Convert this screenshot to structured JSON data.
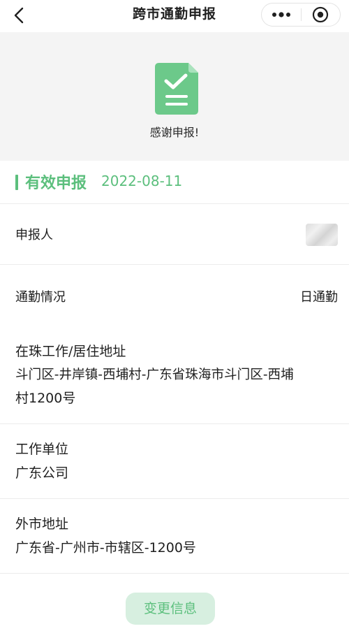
{
  "header": {
    "title": "跨市通勤申报",
    "back_icon": "chevron-left-icon",
    "more_icon": "more-dots-icon",
    "close_icon": "target-close-icon"
  },
  "banner": {
    "icon": "document-check-icon",
    "message": "感谢申报!"
  },
  "section": {
    "title": "有效申报",
    "date": "2022-08-11"
  },
  "fields": {
    "declarant": {
      "label": "申报人"
    },
    "commute": {
      "label": "通勤情况",
      "value": "日通勤"
    },
    "zhuhai_address": {
      "label": "在珠工作/居住地址",
      "value_line1": "斗门区-井岸镇-西埔村-广东省珠海市斗门区-西埔",
      "value_line2": "村1200号"
    },
    "employer": {
      "label": "工作单位",
      "value": "广东公司"
    },
    "other_city_address": {
      "label": "外市地址",
      "value": "广东省-广州市-市辖区-1200号"
    }
  },
  "actions": {
    "change_label": "变更信息"
  },
  "colors": {
    "accent": "#5cbf7d",
    "button_bg": "#d7efe0",
    "banner_bg": "#f4f4f4"
  }
}
